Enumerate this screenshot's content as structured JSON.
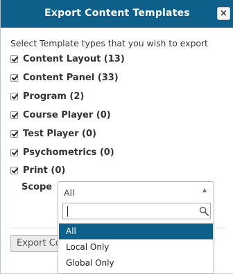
{
  "dialog": {
    "title": "Export Content Templates",
    "close_label": "×",
    "instruction": "Select Template types that you wish to export",
    "options": [
      {
        "label": "Content Layout (13)",
        "checked": true
      },
      {
        "label": "Content Panel (33)",
        "checked": true
      },
      {
        "label": "Program (2)",
        "checked": true
      },
      {
        "label": "Course Player (0)",
        "checked": true
      },
      {
        "label": "Test Player (0)",
        "checked": true
      },
      {
        "label": "Psychometrics (0)",
        "checked": true
      },
      {
        "label": "Print (0)",
        "checked": true
      }
    ],
    "scope": {
      "label": "Scope",
      "selected": "All",
      "search_value": "",
      "results": [
        "All",
        "Local Only",
        "Global Only"
      ],
      "highlighted": "All"
    },
    "export_button_label": "Export Co"
  },
  "colors": {
    "accent": "#0e5f8a"
  }
}
